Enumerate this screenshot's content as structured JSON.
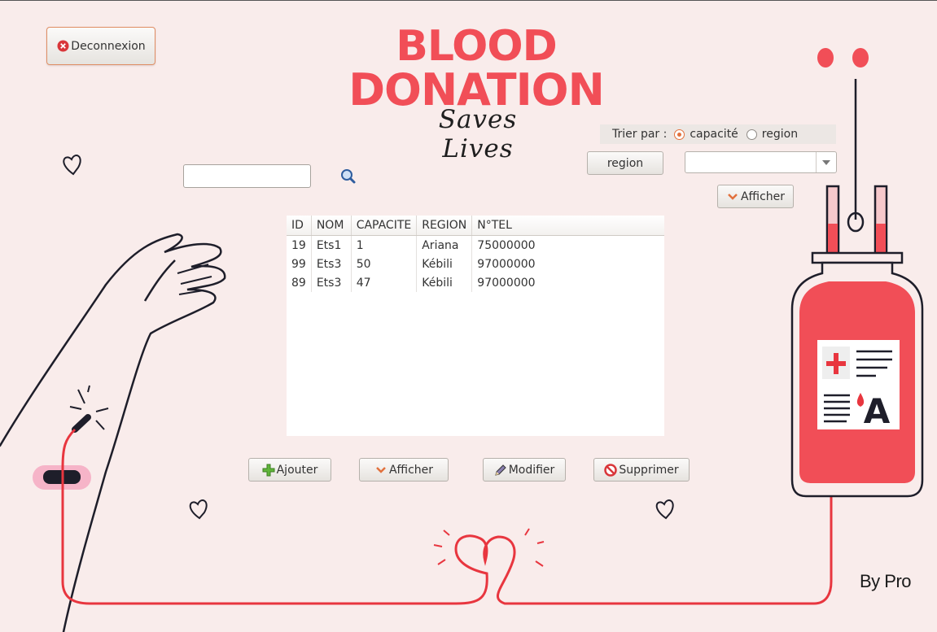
{
  "header": {
    "logout_label": "Deconnexion",
    "title_line1": "BLOOD",
    "title_line2": "DONATION",
    "subtitle": "Saves Lives"
  },
  "search": {
    "value": "",
    "placeholder": ""
  },
  "sort": {
    "label": "Trier par :",
    "options": [
      {
        "label": "capacité",
        "selected": true
      },
      {
        "label": "region",
        "selected": false
      }
    ]
  },
  "filter": {
    "region_button_label": "region",
    "region_select_value": "",
    "afficher_label": "Afficher"
  },
  "table": {
    "columns": [
      "ID",
      "NOM",
      "CAPACITE",
      "REGION",
      "N°TEL"
    ],
    "rows": [
      [
        "19",
        "Ets1",
        "1",
        "Ariana",
        "75000000"
      ],
      [
        "99",
        "Ets3",
        "50",
        "Kébili",
        "97000000"
      ],
      [
        "89",
        "Ets3",
        "47",
        "Kébili",
        "97000000"
      ]
    ]
  },
  "actions": {
    "add_label": "Ajouter",
    "show_label": "Afficher",
    "edit_label": "Modifier",
    "delete_label": "Supprimer"
  },
  "footer": {
    "byline": "By Pro"
  },
  "bag_label": {
    "blood_type": "A"
  },
  "colors": {
    "accent": "#f14e57",
    "background": "#f9eceb",
    "radio_selected": "#e2713d"
  }
}
